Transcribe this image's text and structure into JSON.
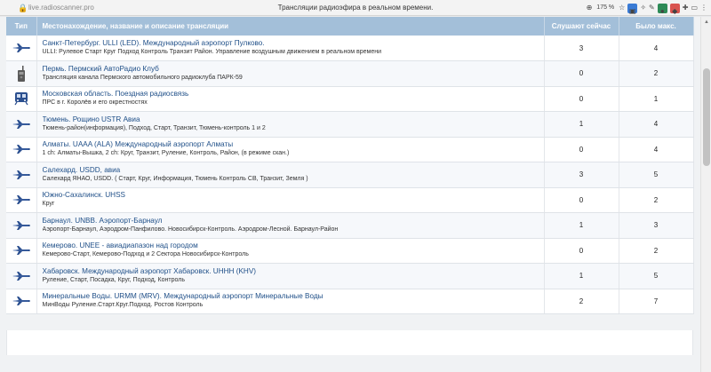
{
  "browser": {
    "url": "live.radioscanner.pro",
    "title": "Трансляции радиоэфира в реальном времени.",
    "zoom": "175 %"
  },
  "table": {
    "headers": {
      "type": "Тип",
      "location": "Местонахождение, название и описание трансляции",
      "listening": "Слушают сейчас",
      "max": "Было макс."
    },
    "rows": [
      {
        "icon": "aircraft-icon",
        "name": "Санкт-Петербург. ULLI (LED). Международный аэропорт Пулково.",
        "desc": "ULLI: Рулевое Старт Круг Подход Контроль Транзит Район. Управление воздушным движением в реальном времени",
        "now": "3",
        "max": "4"
      },
      {
        "icon": "walkie-talkie-icon",
        "name": "Пермь. Пермский АвтоРадио Клуб",
        "desc": "Трансляция канала Пермского автомобильного радиоклуба ПАРК-59",
        "now": "0",
        "max": "2"
      },
      {
        "icon": "train-icon",
        "name": "Московская область. Поездная радиосвязь",
        "desc": "ПРС в г. Королёв и его окрестностях",
        "now": "0",
        "max": "1"
      },
      {
        "icon": "aircraft-icon",
        "name": "Тюмень. Рощино USTR Авиа",
        "desc": "Тюмень-район(информация), Подход, Старт, Транзит, Тюмень-контроль 1 и 2",
        "now": "1",
        "max": "4"
      },
      {
        "icon": "aircraft-icon",
        "name": "Алматы. UAAA (ALA) Международный аэропорт Алматы",
        "desc": "1 ch: Алматы-Вышка, 2 ch: Круг, Транзит, Руление, Контроль, Район, (в режиме скан.)",
        "now": "0",
        "max": "4"
      },
      {
        "icon": "aircraft-icon",
        "name": "Салехард. USDD, авиа",
        "desc": "Салехард ЯНАО, USDD. ( Старт, Круг, Информация, Тюмень Контроль СВ, Транзит, Земля )",
        "now": "3",
        "max": "5"
      },
      {
        "icon": "aircraft-icon",
        "name": "Южно-Сахалинск. UHSS",
        "desc": "Круг",
        "now": "0",
        "max": "2"
      },
      {
        "icon": "aircraft-icon",
        "name": "Барнаул. UNBB. Аэропорт-Барнаул",
        "desc": "Аэропорт-Барнаул, Аэродром-Панфилово. Новосибирск-Контроль. Аэродром-Лесной. Барнаул-Район",
        "now": "1",
        "max": "3"
      },
      {
        "icon": "aircraft-icon",
        "name": "Кемерово. UNEE - авиадиапазон над городом",
        "desc": "Кемерово-Старт, Кемерово-Подход и 2 Сектора Новосибирск-Контроль",
        "now": "0",
        "max": "2"
      },
      {
        "icon": "aircraft-icon",
        "name": "Хабаровск. Международный аэропорт Хабаровск. UHHH (KHV)",
        "desc": "Руление, Старт, Посадка, Круг, Подход, Контроль",
        "now": "1",
        "max": "5"
      },
      {
        "icon": "aircraft-icon",
        "name": "Минеральные Воды. URMM (MRV). Международный аэропорт Минеральные Воды",
        "desc": "МинВоды Руление.Старт.Круг.Подход. Ростов Контроль",
        "now": "2",
        "max": "7"
      }
    ]
  }
}
